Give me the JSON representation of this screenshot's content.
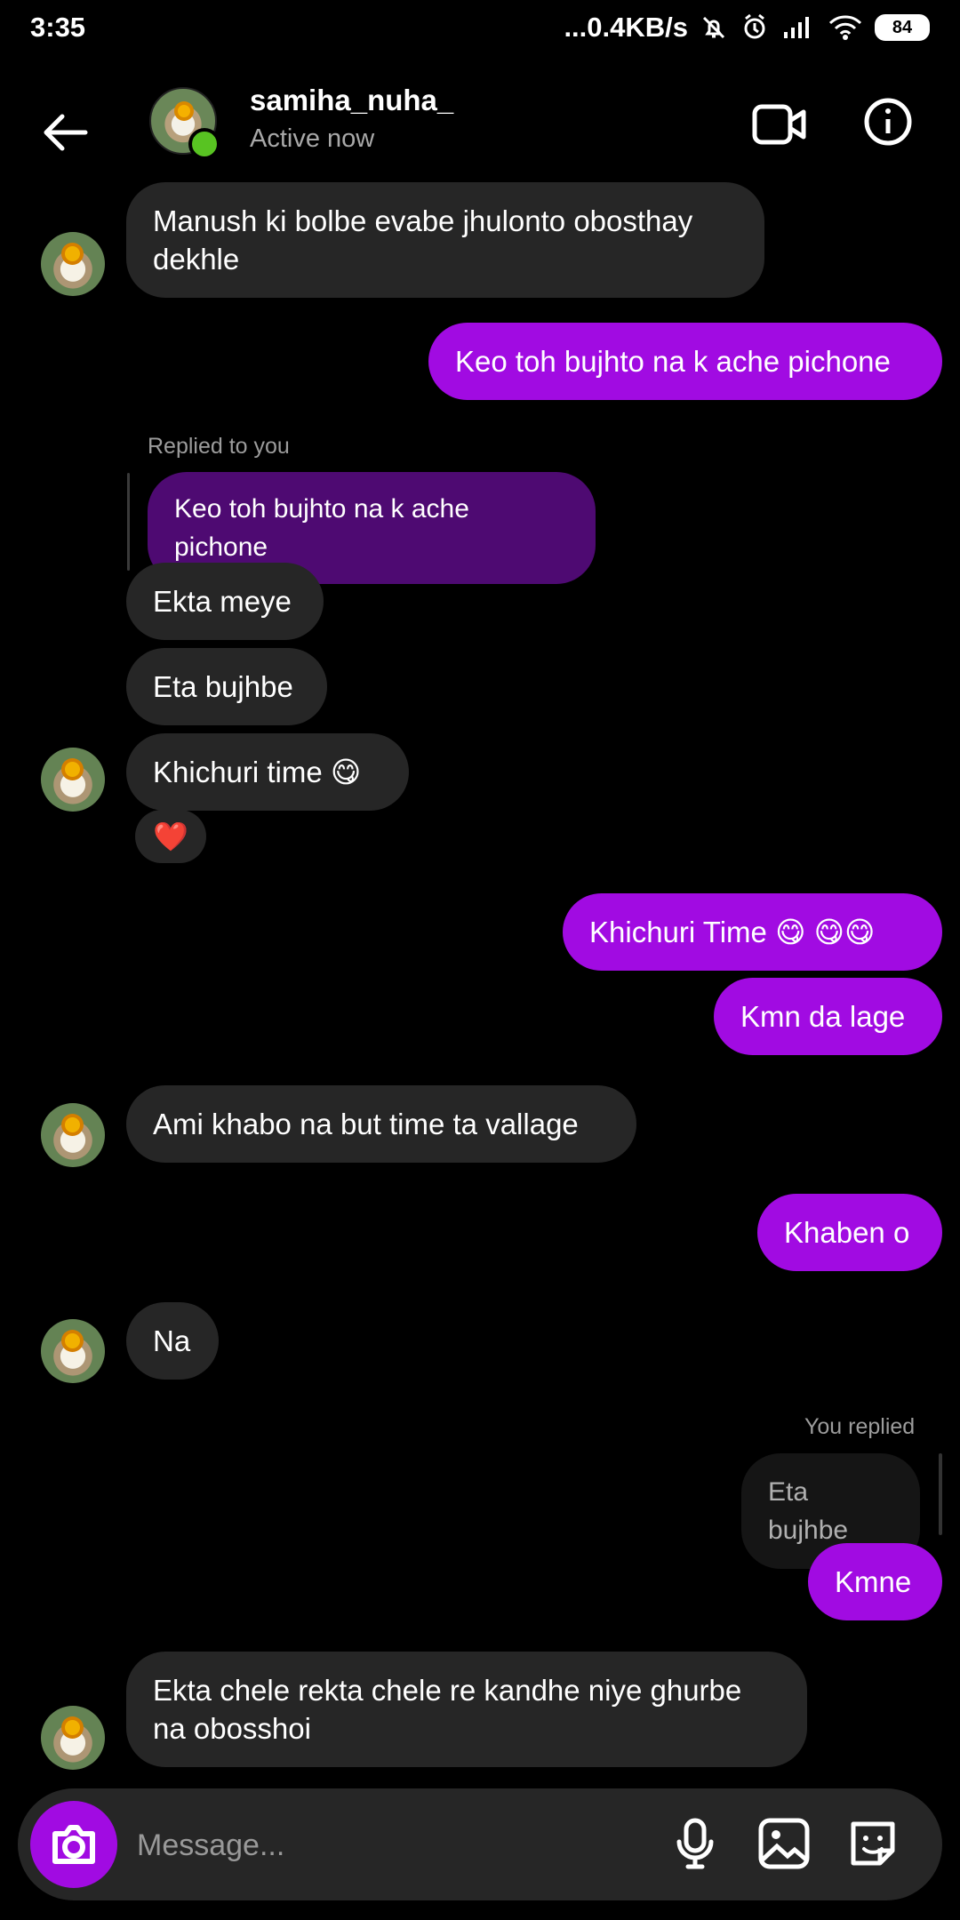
{
  "status_bar": {
    "time": "3:35",
    "network_speed": "...0.4KB/s",
    "battery": "84",
    "icons": [
      "notifications-off-icon",
      "alarm-icon",
      "signal-icon",
      "wifi-icon",
      "battery-icon"
    ]
  },
  "header": {
    "username": "samiha_nuha_",
    "status": "Active now",
    "icons": [
      "back-arrow-icon",
      "video-call-icon",
      "info-icon"
    ]
  },
  "messages": [
    {
      "sender": "them",
      "text": "Manush ki bolbe evabe jhulonto obosthay dekhle"
    },
    {
      "sender": "me",
      "text": "Keo toh bujhto na k ache pichone"
    },
    {
      "type": "reply_label",
      "text": "Replied to you"
    },
    {
      "type": "reply_preview",
      "text": "Keo toh bujhto na k ache pichone"
    },
    {
      "sender": "them",
      "text": "Ekta meye"
    },
    {
      "sender": "them",
      "text": "Eta bujhbe"
    },
    {
      "sender": "them",
      "text": "Khichuri time 😋"
    },
    {
      "type": "reaction",
      "text": "❤️"
    },
    {
      "sender": "me",
      "text": "Khichuri Time 😋 😋😋"
    },
    {
      "sender": "me",
      "text": "Kmn da lage"
    },
    {
      "sender": "them",
      "text": "Ami khabo na but time ta vallage"
    },
    {
      "sender": "me",
      "text": "Khaben o"
    },
    {
      "sender": "them",
      "text": "Na"
    },
    {
      "type": "reply_label",
      "text": "You replied"
    },
    {
      "type": "reply_preview",
      "text": "Eta bujhbe"
    },
    {
      "sender": "me",
      "text": "Kmne"
    },
    {
      "sender": "them",
      "text": "Ekta chele rekta chele re kandhe niye ghurbe na obosshoi"
    }
  ],
  "composer": {
    "placeholder": "Message...",
    "icons": [
      "camera-icon",
      "microphone-icon",
      "gallery-icon",
      "sticker-icon"
    ]
  },
  "colors": {
    "background": "#000000",
    "incoming_bubble": "#262626",
    "outgoing_bubble": "#a10be2",
    "reply_bubble": "#4e0a72",
    "secondary_text": "#a8a8a8",
    "online": "#58c322"
  }
}
